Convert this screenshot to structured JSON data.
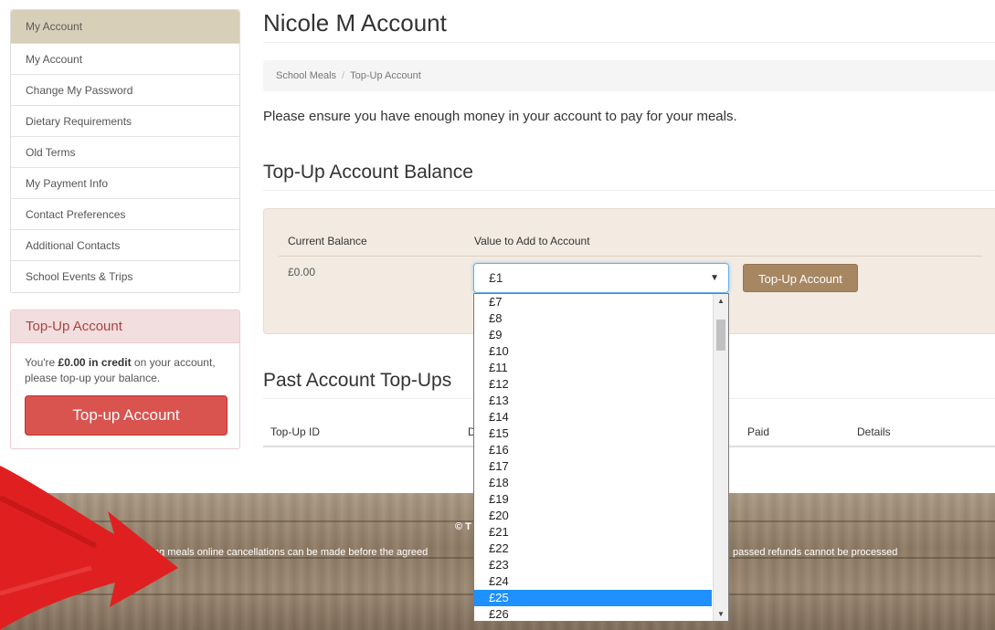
{
  "sidebar": {
    "header": "My Account",
    "items": [
      {
        "label": "My Account"
      },
      {
        "label": "Change My Password"
      },
      {
        "label": "Dietary Requirements"
      },
      {
        "label": "Old Terms"
      },
      {
        "label": "My Payment Info"
      },
      {
        "label": "Contact Preferences"
      },
      {
        "label": "Additional Contacts"
      },
      {
        "label": "School Events & Trips"
      }
    ],
    "topup_panel": {
      "title": "Top-Up Account",
      "text_before": "You're ",
      "credit_text": "£0.00 in credit",
      "text_after": " on your account, please top-up your balance.",
      "button_label": "Top-up Account"
    }
  },
  "page": {
    "title": "Nicole M Account",
    "breadcrumb": {
      "parent": "School Meals",
      "separator": "/",
      "current": "Top-Up Account"
    },
    "info": "Please ensure you have enough money in your account to pay for your meals.",
    "section_title": "Top-Up Account Balance"
  },
  "balance": {
    "current_label": "Current Balance",
    "value_label": "Value to Add to Account",
    "current_value": "£0.00",
    "selected_value": "£1",
    "button_label": "Top-Up Account"
  },
  "dropdown": {
    "options": [
      "£7",
      "£8",
      "£9",
      "£10",
      "£11",
      "£12",
      "£13",
      "£14",
      "£15",
      "£16",
      "£17",
      "£18",
      "£19",
      "£20",
      "£21",
      "£22",
      "£23",
      "£24",
      "£25",
      "£26"
    ],
    "highlighted": "£25"
  },
  "past": {
    "title": "Past Account Top-Ups",
    "columns": {
      "id": "Top-Up ID",
      "d": "D",
      "paid": "Paid",
      "details": "Details"
    }
  },
  "footer": {
    "copyright": "© T",
    "left_text": "ng meals online cancellations can be made before the agreed",
    "right_text": "passed refunds cannot be processed"
  }
}
